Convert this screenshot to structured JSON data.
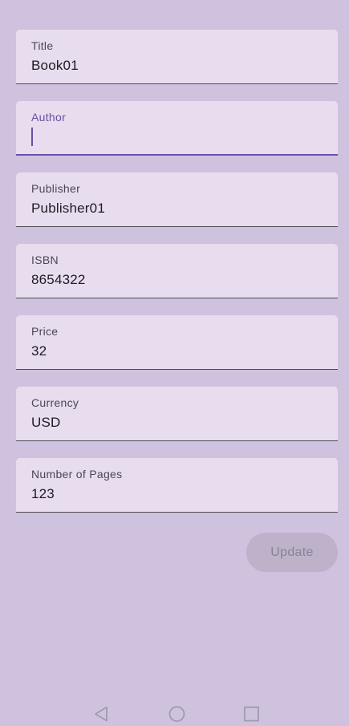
{
  "form": {
    "fields": [
      {
        "label": "Title",
        "value": "Book01"
      },
      {
        "label": "Author",
        "value": ""
      },
      {
        "label": "Publisher",
        "value": "Publisher01"
      },
      {
        "label": "ISBN",
        "value": "8654322"
      },
      {
        "label": "Price",
        "value": "32"
      },
      {
        "label": "Currency",
        "value": "USD"
      },
      {
        "label": "Number of Pages",
        "value": "123"
      }
    ],
    "update_label": "Update"
  },
  "nav": {
    "icons": [
      "back-icon",
      "home-icon",
      "recents-icon"
    ]
  },
  "colors": {
    "background": "#cfc2df",
    "field_background": "#e8ddee",
    "accent": "#6750a4"
  }
}
